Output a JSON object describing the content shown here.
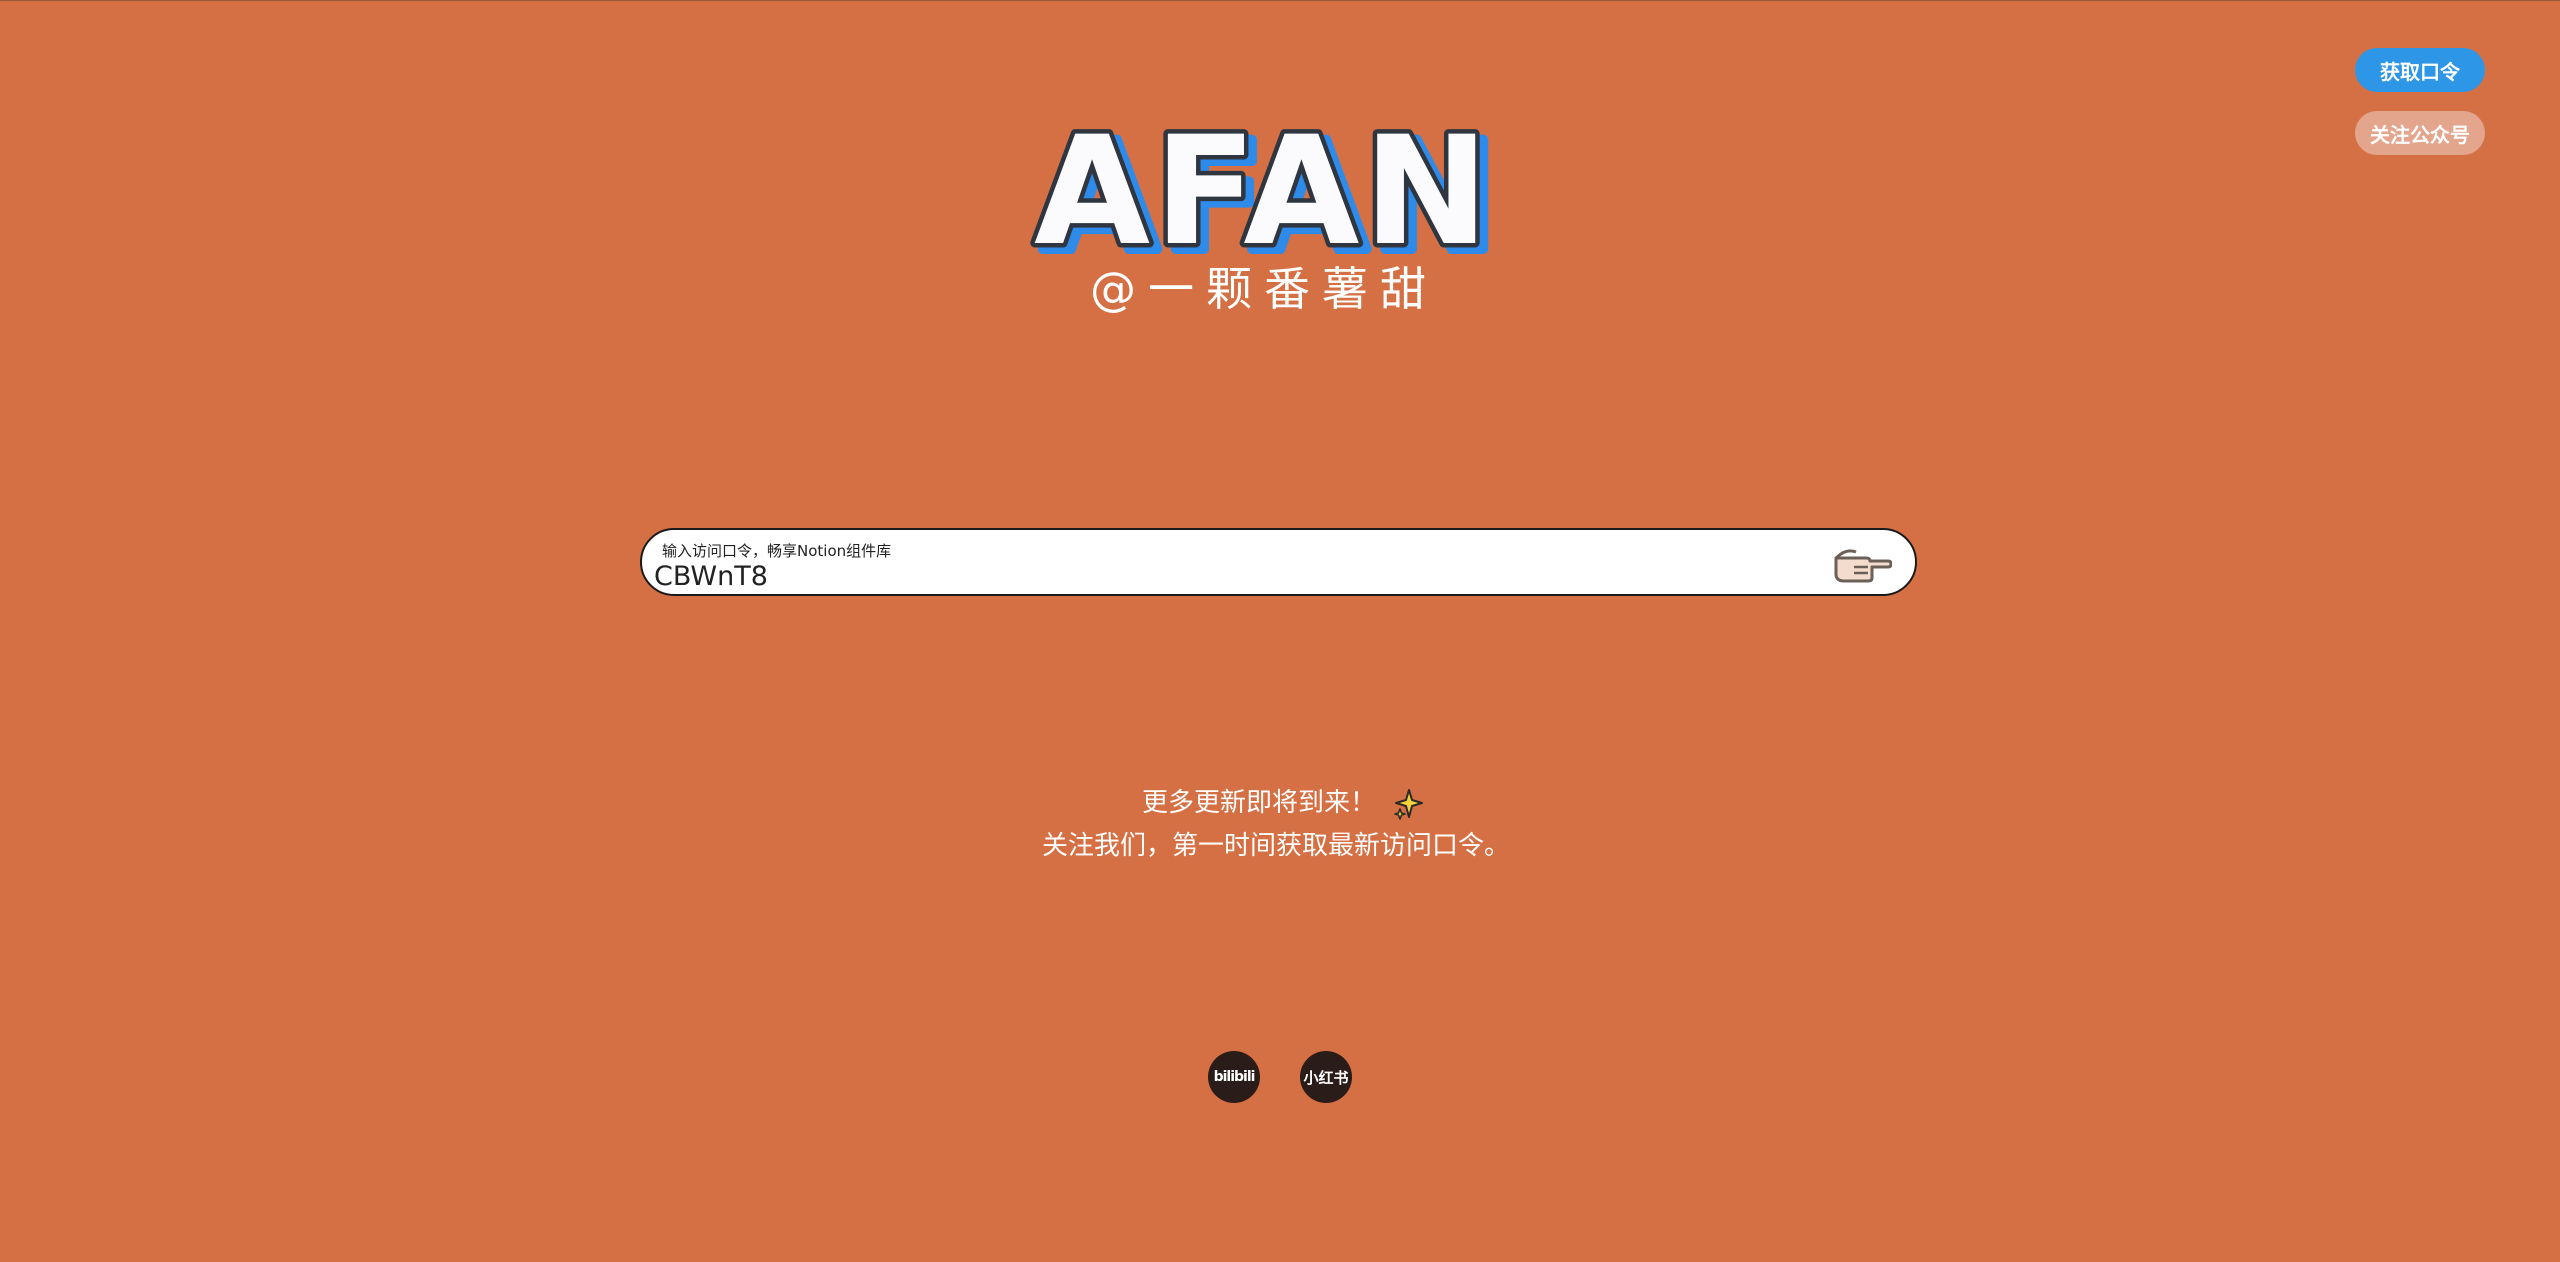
{
  "header": {
    "get_code_label": "获取口令",
    "follow_label": "关注公众号"
  },
  "logo": {
    "text": "AFAN",
    "subtitle": "@一颗番薯甜",
    "colors": {
      "fill": "#FBFBFD",
      "outline": "#2F3640",
      "shadow": "#2E8BEA"
    }
  },
  "search": {
    "label": "输入访问口令，畅享Notion组件库",
    "value": "CBWnT8",
    "submit_icon": "pointing-hand-icon"
  },
  "message": {
    "line1": "更多更新即将到来！",
    "line1_icon": "sparkles-icon",
    "line2": "关注我们，第一时间获取最新访问口令。"
  },
  "social": {
    "bilibili_label": "bilibili",
    "xiaohongshu_label": "小红书"
  },
  "colors": {
    "background": "#D57044",
    "primary_button": "#2E96E6",
    "secondary_button": "#E3A58C"
  }
}
